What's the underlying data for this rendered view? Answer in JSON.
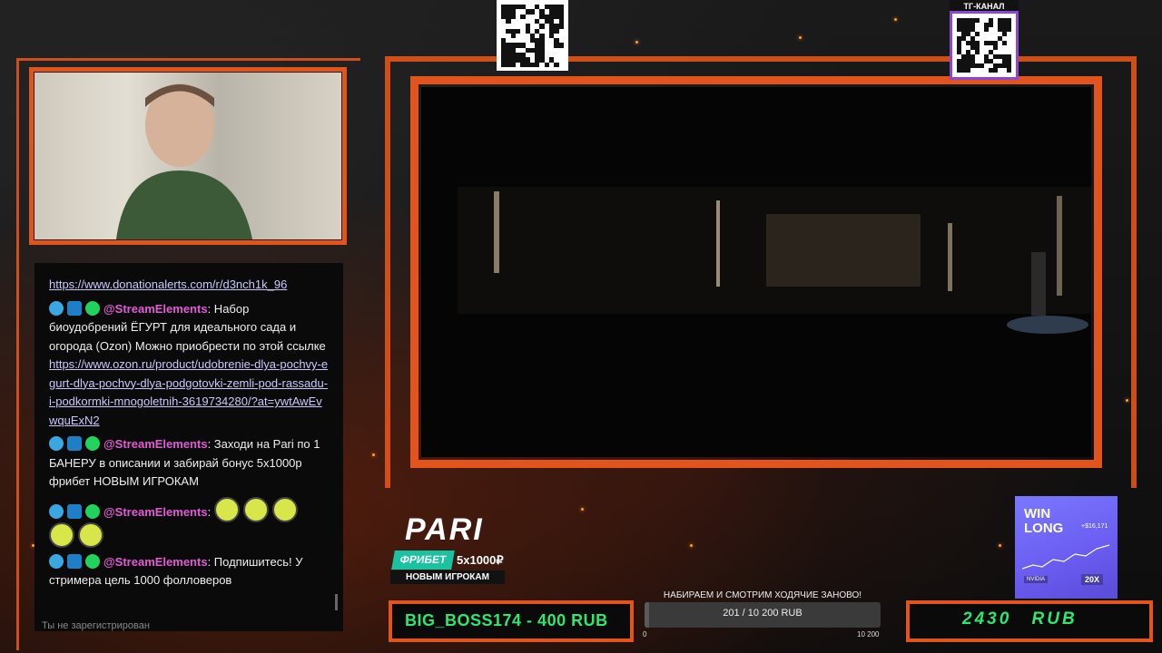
{
  "stream": {
    "chat": {
      "messages": [
        {
          "text": "https://www.donationalerts.com/r/d3nch1k_96",
          "is_link": true
        },
        {
          "user": "@StreamElements",
          "sep": ":",
          "text": " Набор биоудобрений ЁГУРТ для идеального сада и огорода (Ozon) Можно приобрести по этой ссылке",
          "link": "https://www.ozon.ru/product/udobrenie-dlya-pochvy-egurt-dlya-pochvy-dlya-podgotovki-zemli-pod-rassadu-i-podkormki-mnogoletnih-3619734280/?at=ywtAwEvwquExN2"
        },
        {
          "user": "@StreamElements",
          "sep": ":",
          "text": " Заходи на Pari по 1 БАНЕРУ в описании и забирай бонус 5х1000р фрибет НОВЫМ ИГРОКАМ"
        },
        {
          "user": "@StreamElements",
          "sep": ":",
          "text": ""
        },
        {
          "user": "@StreamElements",
          "sep": ":",
          "text": " Подпишитесь! У стримера цель 1000 фолловеров"
        }
      ],
      "footer": "Ты не зарегистрирован"
    },
    "tg_label": "ТГ-КАНАЛ",
    "pari": {
      "logo": "PARI",
      "freebet": "ФРИБЕТ",
      "bonus": "5x1000₽",
      "new_players": "НОВЫМ ИГРОКАМ"
    },
    "donor": "BIG_BOSS174 - 400 RUB",
    "goal": {
      "title": "НАБИРАЕМ И СМОТРИМ ХОДЯЧИЕ ЗАНОВО!",
      "progress_text": "201 / 10 200 RUB",
      "min": "0",
      "max": "10 200",
      "fraction": 0.0197
    },
    "total": "2430 RUB",
    "ad": {
      "title_line1": "WIN",
      "title_line2": "LONG",
      "value": "+$16,171",
      "leverage": "20X",
      "brand": "NVIDIA"
    },
    "colors": {
      "frame": "#e2541c",
      "donor_text": "#2ee672",
      "tg_border": "#8c45d6",
      "pari_green": "#19c2a0"
    }
  }
}
